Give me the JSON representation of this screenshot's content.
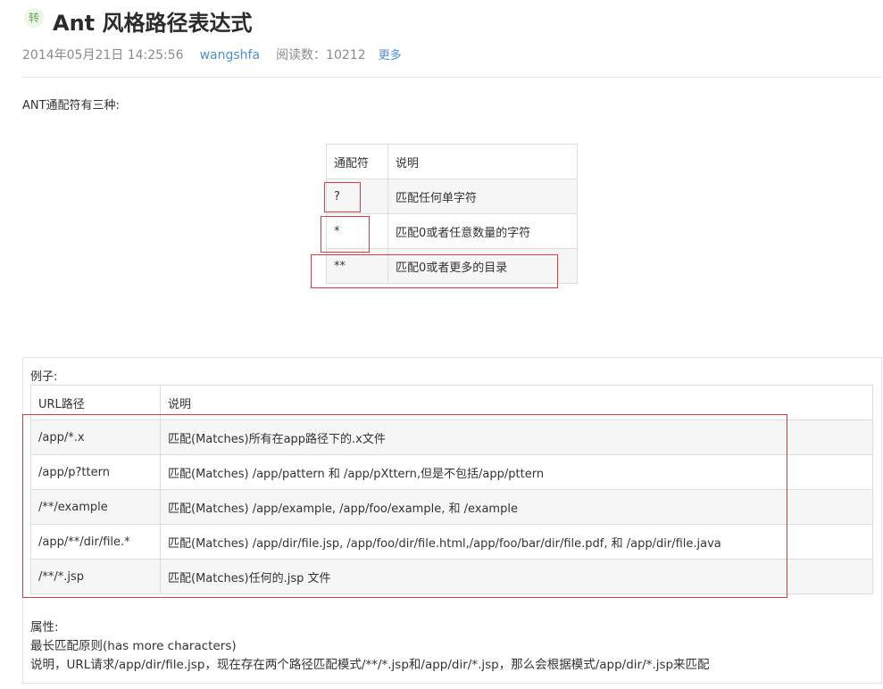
{
  "header": {
    "badge": "转",
    "title": "Ant 风格路径表达式",
    "date": "2014年05月21日 14:25:56",
    "author": "wangshfa",
    "reads": "阅读数：10212",
    "more": "更多"
  },
  "intro": "ANT通配符有三种:",
  "wildcards": {
    "header": [
      "通配符",
      "说明"
    ],
    "rows": [
      [
        "?",
        "匹配任何单字符"
      ],
      [
        "*",
        "匹配0或者任意数量的字符"
      ],
      [
        "**",
        "匹配0或者更多的目录"
      ]
    ]
  },
  "examples": {
    "label": "例子:",
    "header": [
      "URL路径",
      "说明"
    ],
    "rows": [
      [
        "/app/*.x",
        "匹配(Matches)所有在app路径下的.x文件"
      ],
      [
        "/app/p?ttern",
        "匹配(Matches) /app/pattern 和 /app/pXttern,但是不包括/app/pttern"
      ],
      [
        "/**/example",
        "匹配(Matches) /app/example, /app/foo/example, 和 /example"
      ],
      [
        "/app/**/dir/file.*",
        "匹配(Matches) /app/dir/file.jsp, /app/foo/dir/file.html,/app/foo/bar/dir/file.pdf, 和 /app/dir/file.java"
      ],
      [
        "/**/*.jsp",
        "匹配(Matches)任何的.jsp 文件"
      ]
    ]
  },
  "properties": {
    "label": "属性:",
    "line1": "最长匹配原则(has more characters)",
    "line2": "说明，URL请求/app/dir/file.jsp，现在存在两个路径匹配模式/**/*.jsp和/app/dir/*.jsp，那么会根据模式/app/dir/*.jsp来匹配"
  },
  "colors": {
    "highlight": "#e03c3c",
    "link": "#4f8fd1"
  }
}
